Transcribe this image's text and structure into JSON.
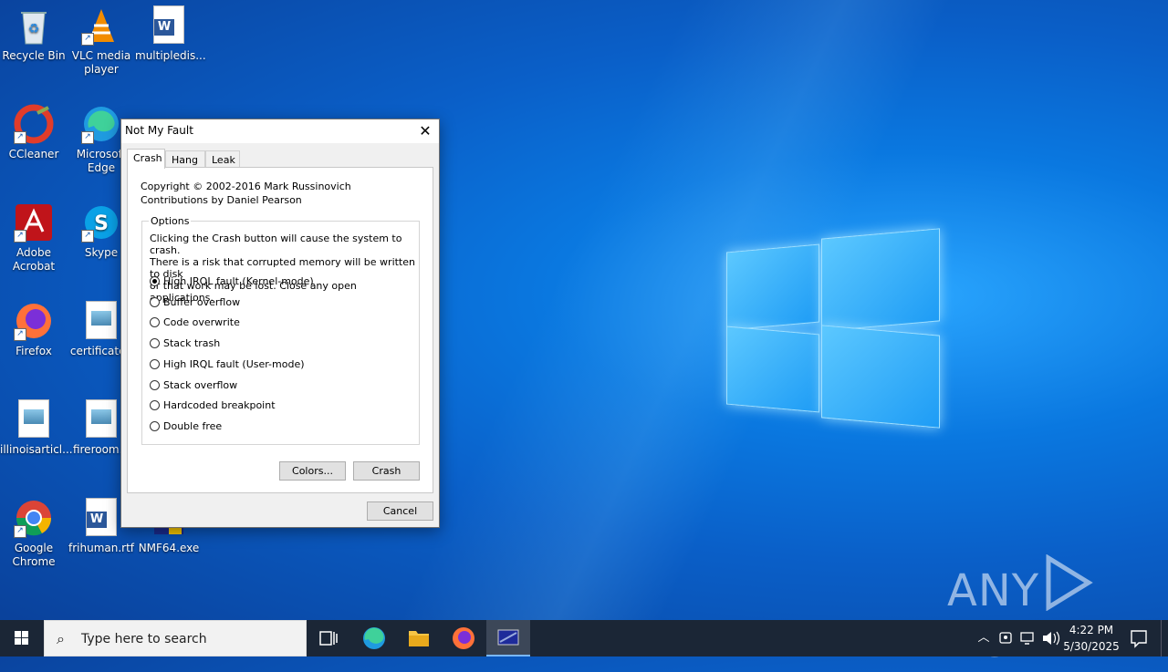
{
  "desktop": {
    "icons": [
      {
        "label": "Recycle Bin",
        "icon": "recycle-bin-icon"
      },
      {
        "label": "VLC media player",
        "icon": "vlc-icon"
      },
      {
        "label": "multipledis...",
        "icon": "word-doc-icon"
      },
      {
        "label": "CCleaner",
        "icon": "ccleaner-icon"
      },
      {
        "label": "Microsoft Edge",
        "icon": "edge-icon"
      },
      {
        "label": "Adobe Acrobat",
        "icon": "acrobat-icon"
      },
      {
        "label": "Skype",
        "icon": "skype-icon"
      },
      {
        "label": "Firefox",
        "icon": "firefox-icon"
      },
      {
        "label": "certificateh",
        "icon": "image-file-icon"
      },
      {
        "label": "illinoisarticl...",
        "icon": "image-file-icon"
      },
      {
        "label": "fireroom.p",
        "icon": "image-file-icon"
      },
      {
        "label": "Google Chrome",
        "icon": "chrome-icon"
      },
      {
        "label": "frihuman.rtf",
        "icon": "word-doc-icon"
      },
      {
        "label": "NMF64.exe",
        "icon": "exe-icon"
      }
    ]
  },
  "dialog": {
    "title": "Not My Fault",
    "tabs": [
      {
        "label": "Crash",
        "active": true
      },
      {
        "label": "Hang",
        "active": false
      },
      {
        "label": "Leak",
        "active": false
      }
    ],
    "copyright": "Copyright © 2002-2016 Mark Russinovich",
    "contributions": "Contributions by Daniel Pearson",
    "options_label": "Options",
    "description_lines": [
      "Clicking the Crash button will cause the system to crash.",
      "There is a risk that corrupted memory will be written to disk",
      "or that work may be lost. Close any open applications."
    ],
    "options": [
      {
        "label": "High IRQL fault (Kernel-mode)",
        "selected": true
      },
      {
        "label": "Buffer overflow",
        "selected": false
      },
      {
        "label": "Code overwrite",
        "selected": false
      },
      {
        "label": "Stack trash",
        "selected": false
      },
      {
        "label": "High IRQL fault (User-mode)",
        "selected": false
      },
      {
        "label": "Stack overflow",
        "selected": false
      },
      {
        "label": "Hardcoded breakpoint",
        "selected": false
      },
      {
        "label": "Double free",
        "selected": false
      }
    ],
    "colors_button": "Colors...",
    "crash_button": "Crash",
    "cancel_button": "Cancel"
  },
  "taskbar": {
    "search_placeholder": "Type here to search",
    "time": "4:22 PM",
    "date": "5/30/2025"
  },
  "watermark": "ANY RUN"
}
